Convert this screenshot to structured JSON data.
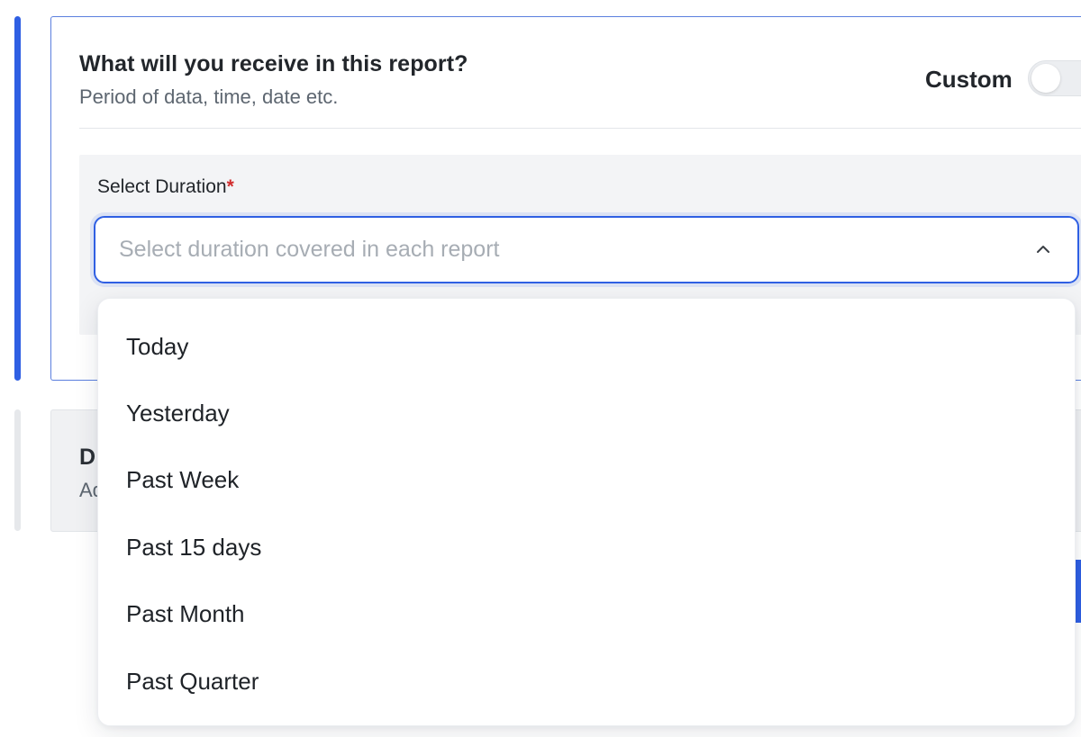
{
  "report_card": {
    "title": "What will you receive in this report?",
    "subtitle": "Period of data, time, date etc.",
    "custom_label": "Custom",
    "custom_toggle_on": false
  },
  "duration_field": {
    "label": "Select Duration",
    "required_mark": "*",
    "placeholder": "Select duration covered in each report",
    "open": true
  },
  "dropdown": {
    "options": [
      {
        "label": "Today"
      },
      {
        "label": "Yesterday"
      },
      {
        "label": "Past Week"
      },
      {
        "label": "Past 15 days"
      },
      {
        "label": "Past Month"
      },
      {
        "label": "Past Quarter"
      }
    ]
  },
  "collapsed_card": {
    "title_visible": "D",
    "subtitle_visible": "Ad"
  },
  "colors": {
    "accent": "#2f5fe3",
    "required": "#d12d2d",
    "placeholder": "#a7adb4"
  }
}
